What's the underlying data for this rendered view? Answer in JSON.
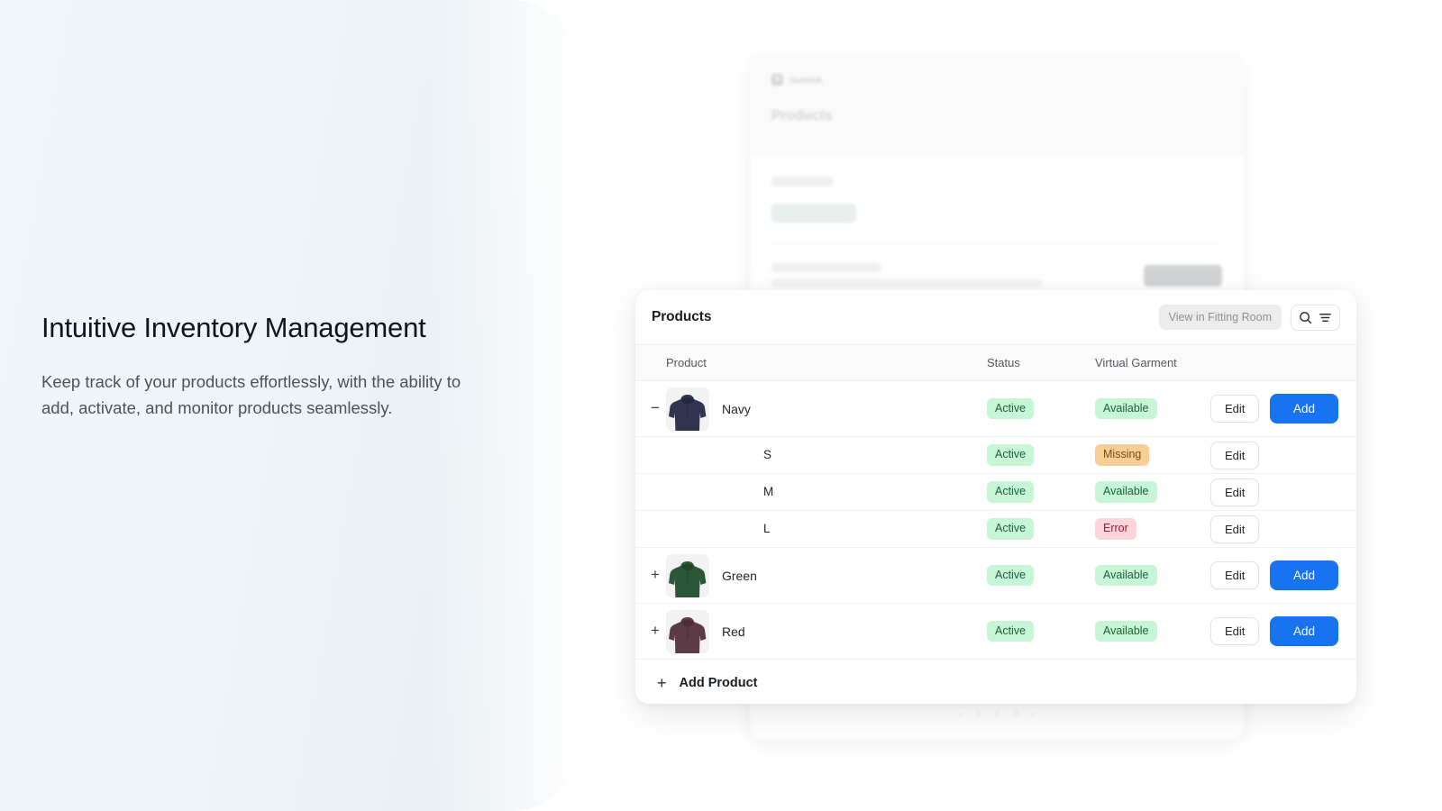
{
  "hero": {
    "headline": "Intuitive Inventory Management",
    "subcopy": "Keep track of your products effortlessly, with the ability to add, activate, and monitor products seamlessly."
  },
  "background_app": {
    "logo_text": "OutfitXR",
    "page_title": "Products",
    "pagination": [
      "‹",
      "1",
      "2",
      "3",
      "›"
    ]
  },
  "card": {
    "title": "Products",
    "fitting_room_button": "View in Fitting Room",
    "search_icon": "search-icon",
    "filter_icon": "filter-icon",
    "columns": {
      "product": "Product",
      "status": "Status",
      "virtual_garment": "Virtual Garment"
    },
    "rows": [
      {
        "type": "product",
        "toggle": "−",
        "toggle_state": "expanded",
        "name": "Navy",
        "thumb_color": "#31344f",
        "status": "Active",
        "status_style": "b-active",
        "garment": "Available",
        "garment_style": "b-available",
        "edit_label": "Edit",
        "add_label": "Add"
      },
      {
        "type": "variant",
        "name": "S",
        "status": "Active",
        "status_style": "b-active",
        "garment": "Missing",
        "garment_style": "b-missing",
        "edit_label": "Edit",
        "add_label": ""
      },
      {
        "type": "variant",
        "name": "M",
        "status": "Active",
        "status_style": "b-active",
        "garment": "Available",
        "garment_style": "b-available",
        "edit_label": "Edit",
        "add_label": ""
      },
      {
        "type": "variant",
        "name": "L",
        "status": "Active",
        "status_style": "b-active",
        "garment": "Error",
        "garment_style": "b-error",
        "edit_label": "Edit",
        "add_label": ""
      },
      {
        "type": "product",
        "toggle": "+",
        "toggle_state": "collapsed",
        "name": "Green",
        "thumb_color": "#2c5638",
        "status": "Active",
        "status_style": "b-active",
        "garment": "Available",
        "garment_style": "b-available",
        "edit_label": "Edit",
        "add_label": "Add"
      },
      {
        "type": "product",
        "toggle": "+",
        "toggle_state": "collapsed",
        "name": "Red",
        "thumb_color": "#5c3a46",
        "status": "Active",
        "status_style": "b-active",
        "garment": "Available",
        "garment_style": "b-available",
        "edit_label": "Edit",
        "add_label": "Add"
      }
    ],
    "footer": {
      "plus": "+",
      "label": "Add Product"
    }
  },
  "colors": {
    "accent_blue": "#1773f0",
    "badge_green_bg": "#c6f6d5",
    "badge_green_text": "#1d6238",
    "badge_orange_bg": "#f9cd96",
    "badge_orange_text": "#7d4a12",
    "badge_red_bg": "#fbd5da",
    "badge_red_text": "#9b1c2a",
    "panel_tint": "#eff7fa"
  }
}
